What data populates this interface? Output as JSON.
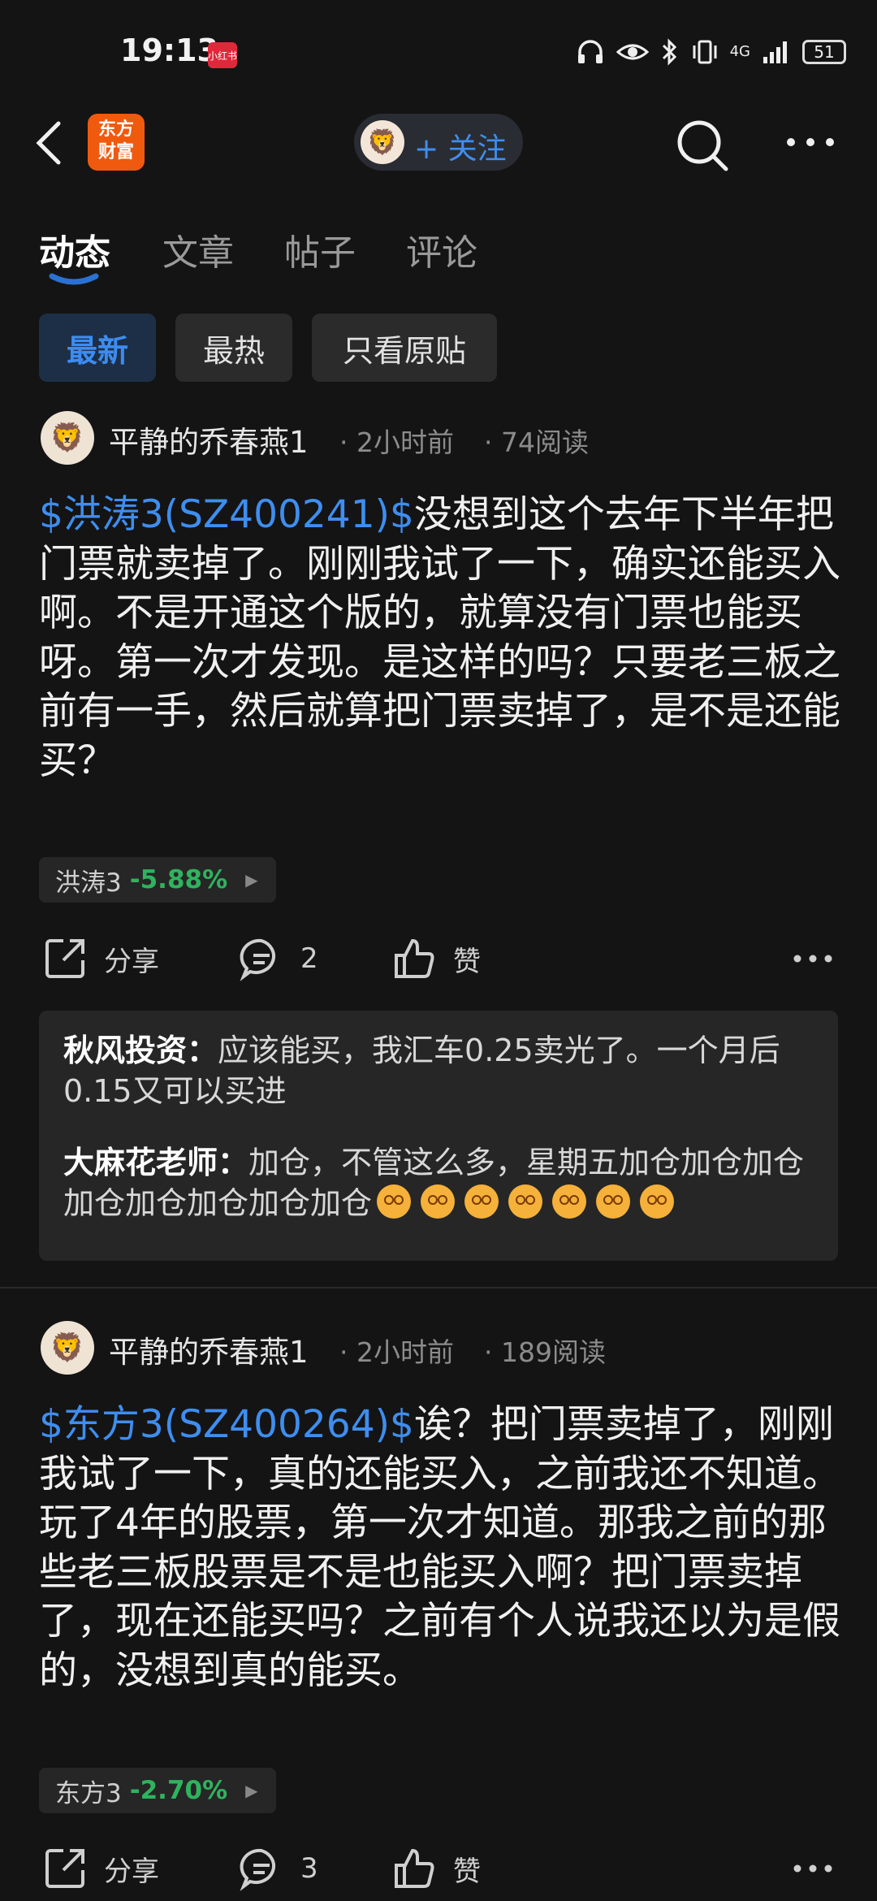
{
  "status": {
    "time": "19:13",
    "app_badge": "小红书",
    "network": "4G",
    "battery": "51"
  },
  "header": {
    "brand_line1": "东方",
    "brand_line2": "财富",
    "follow_label": "+ 关注",
    "avatar_icon": "lion-avatar"
  },
  "tabs": [
    {
      "label": "动态",
      "active": true
    },
    {
      "label": "文章",
      "active": false
    },
    {
      "label": "帖子",
      "active": false
    },
    {
      "label": "评论",
      "active": false
    }
  ],
  "filters": [
    {
      "label": "最新",
      "active": true
    },
    {
      "label": "最热",
      "active": false
    },
    {
      "label": "只看原贴",
      "active": false
    }
  ],
  "posts": [
    {
      "author": "平静的乔春燕1",
      "time": "· 2小时前",
      "reads": "· 74阅读",
      "cashtag": "$洪涛3(SZ400241)$",
      "text": "没想到这个去年下半年把门票就卖掉了。刚刚我试了一下，确实还能买入啊。不是开通这个版的，就算没有门票也能买呀。第一次才发现。是这样的吗？只要老三板之前有一手，然后就算把门票卖掉了，是不是还能买？",
      "stock_name": "洪涛3",
      "stock_change": "-5.88%",
      "share_label": "分享",
      "comment_count": "2",
      "like_label": "赞",
      "comments": [
        {
          "user": "秋风投资：",
          "text": "应该能买，我汇车0.25卖光了。一个月后0.15又可以买进"
        },
        {
          "user": "大麻花老师：",
          "text": "加仓，不管这么多，星期五加仓加仓加仓加仓加仓加仓加仓加仓"
        }
      ]
    },
    {
      "author": "平静的乔春燕1",
      "time": "· 2小时前",
      "reads": "· 189阅读",
      "cashtag": "$东方3(SZ400264)$",
      "text": "诶？把门票卖掉了，刚刚我试了一下，真的还能买入，之前我还不知道。玩了4年的股票，第一次才知道。那我之前的那些老三板股票是不是也能买入啊？把门票卖掉了，现在还能买吗？之前有个人说我还以为是假的，没想到真的能买。",
      "stock_name": "东方3",
      "stock_change": "-2.70%",
      "share_label": "分享",
      "comment_count": "3",
      "like_label": "赞"
    }
  ],
  "colors": {
    "accent": "#3e8ef0",
    "down": "#2fb35e",
    "background": "#141414"
  }
}
